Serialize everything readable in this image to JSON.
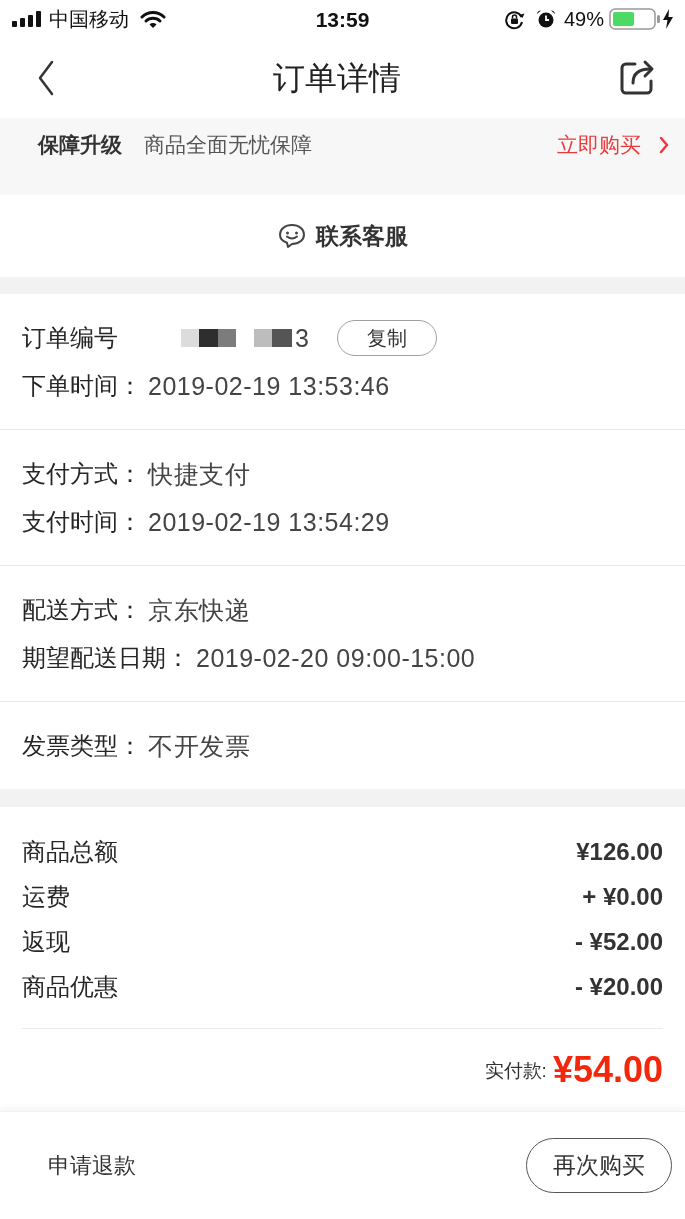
{
  "status_bar": {
    "carrier": "中国移动",
    "time": "13:59",
    "battery_percent": "49%"
  },
  "nav_bar": {
    "title": "订单详情"
  },
  "protection_banner": {
    "title": "保障升级",
    "description": "商品全面无忧保障",
    "action": "立即购买"
  },
  "contact_service": {
    "label": "联系客服"
  },
  "info_sections": [
    {
      "rows": [
        {
          "kind": "order_number",
          "label": "订单编号",
          "value": "3",
          "button": "复制"
        },
        {
          "kind": "field",
          "label": "下单时间：",
          "value": "2019-02-19 13:53:46"
        }
      ]
    },
    {
      "rows": [
        {
          "kind": "field",
          "label": "支付方式：",
          "value": "快捷支付"
        },
        {
          "kind": "field",
          "label": "支付时间：",
          "value": "2019-02-19 13:54:29"
        }
      ]
    },
    {
      "rows": [
        {
          "kind": "field",
          "label": "配送方式：",
          "value": "京东快递"
        },
        {
          "kind": "field",
          "label": "期望配送日期：",
          "value": "2019-02-20 09:00-15:00"
        }
      ]
    },
    {
      "rows": [
        {
          "kind": "field",
          "label": "发票类型：",
          "value": "不开发票"
        }
      ]
    }
  ],
  "price_summary": {
    "rows": [
      {
        "label": "商品总额",
        "value": "¥126.00"
      },
      {
        "label": "运费",
        "value": "+ ¥0.00"
      },
      {
        "label": "返现",
        "value": "- ¥52.00"
      },
      {
        "label": "商品优惠",
        "value": "- ¥20.00"
      }
    ],
    "total": {
      "label": "实付款:",
      "value": "¥54.00"
    }
  },
  "bottom_bar": {
    "secondary_action": "申请退款",
    "primary_action": "再次购买"
  }
}
